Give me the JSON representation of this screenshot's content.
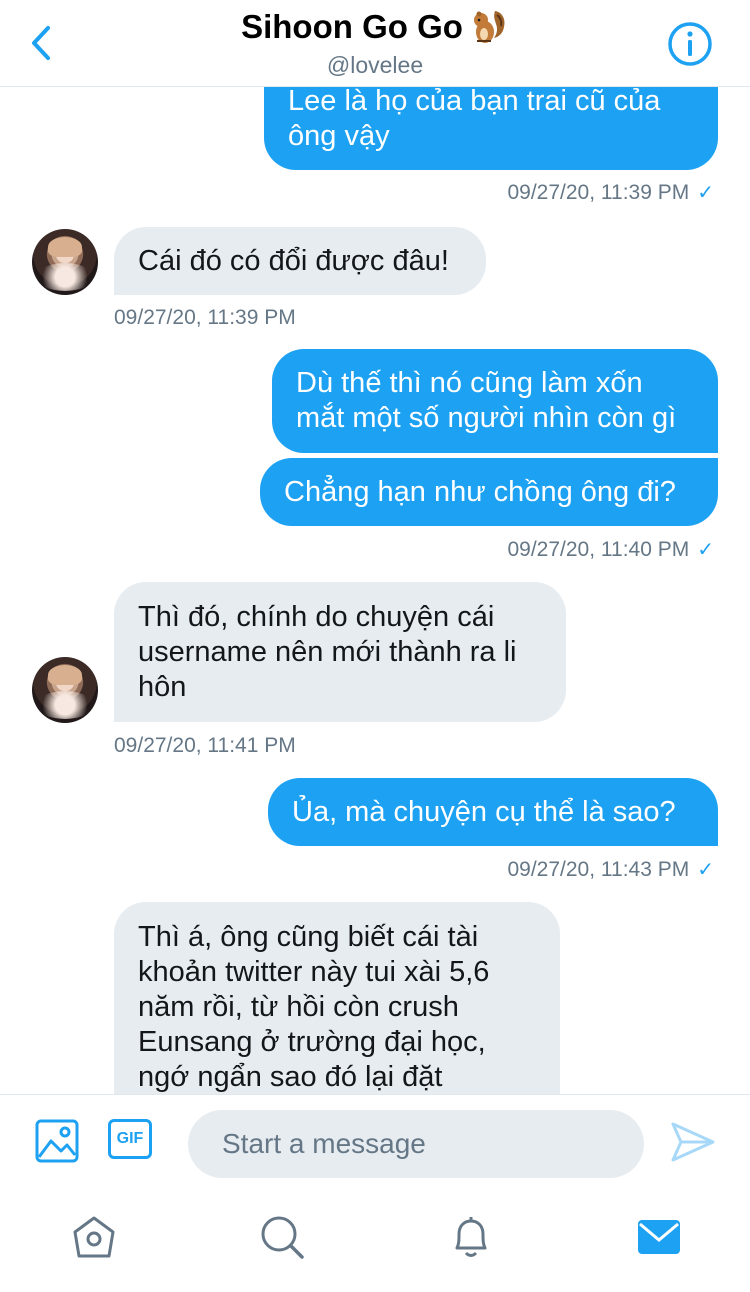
{
  "header": {
    "title": "Sihoon Go Go",
    "handle": "@lovelee",
    "emoji_icon": "chipmunk-icon",
    "accent": "#1da1f2"
  },
  "messages": [
    {
      "side": "out",
      "text": "Lee là họ của bạn trai cũ của ông vậy",
      "lines": [
        "Lee là họ của bạn trai cũ của",
        "ông vậy"
      ]
    },
    {
      "kind": "timestamp",
      "side": "out",
      "text": "09/27/20, 11:39 PM",
      "read": "✓"
    },
    {
      "side": "in",
      "text": "Cái đó có đổi được đâu!"
    },
    {
      "kind": "timestamp",
      "side": "in",
      "text": "09/27/20, 11:39 PM"
    },
    {
      "side": "out",
      "lines": [
        "Dù thế thì nó cũng làm xốn",
        "mắt một số người nhìn còn gì"
      ]
    },
    {
      "side": "out",
      "text": "Chẳng hạn như chồng ông đi?"
    },
    {
      "kind": "timestamp",
      "side": "out",
      "text": "09/27/20, 11:40 PM",
      "read": "✓"
    },
    {
      "side": "in",
      "lines": [
        "Thì đó, chính do chuyện cái",
        "username nên mới thành ra li",
        "hôn"
      ]
    },
    {
      "kind": "timestamp",
      "side": "in",
      "text": "09/27/20, 11:41 PM"
    },
    {
      "side": "out",
      "text": "Ủa, mà chuyện cụ thể là sao?"
    },
    {
      "kind": "timestamp",
      "side": "out",
      "text": "09/27/20, 11:43 PM",
      "read": "✓"
    },
    {
      "side": "in",
      "lines": [
        "Thì á, ông cũng biết cái tài",
        "khoản twitter này tui xài 5,6",
        "năm rồi, từ hồi còn crush",
        "Eunsang ở trường đại học,",
        "ngớ ngẩn sao đó lại đặt"
      ]
    }
  ],
  "composer": {
    "placeholder": "Start a message",
    "gif_label": "GIF",
    "media_icon": "image-icon",
    "send_icon": "send-icon"
  },
  "tabbar": {
    "items": [
      "home-icon",
      "search-icon",
      "notifications-icon",
      "messages-icon"
    ],
    "active": "messages-icon"
  },
  "colors": {
    "outgoing_bubble": "#1da1f2",
    "incoming_bubble": "#e6ecf0",
    "muted_text": "#657786"
  }
}
